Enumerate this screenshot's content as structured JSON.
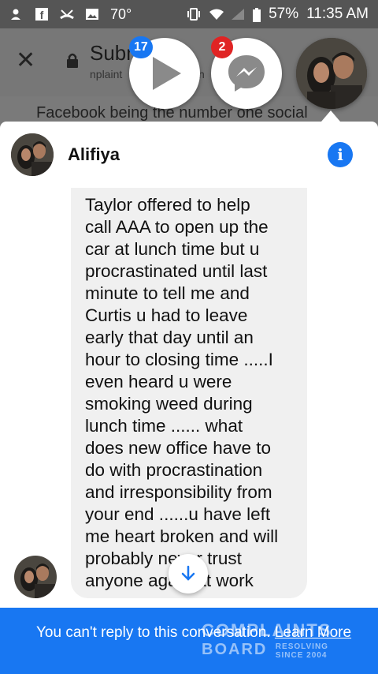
{
  "status_bar": {
    "temperature": "70°",
    "battery": "57%",
    "time": "11:35 AM"
  },
  "browser": {
    "title": "Subm",
    "url": "nplaint",
    "url_tail": "n",
    "behind_text": "Facebook being the number one social"
  },
  "chat_heads": {
    "video_badge": "17",
    "messenger_badge": "2"
  },
  "conversation": {
    "contact_name": "Alifiya",
    "message": "Taylor offered to help\ncall AAA to open up the\ncar at lunch time but u\nprocrastinated until last\nminute to tell me and\nCurtis u had to leave\nearly that day until an\nhour to closing time .....I\neven heard u were\nsmoking weed during\nlunch time ...... what\ndoes new office have to\ndo with procrastination\nand irresponsibility from\nyour end ......u have left\nme heart broken and will\nprobably never trust\nanyone again at work"
  },
  "footer": {
    "notice": "You can't reply to this conversation.",
    "link": "Learn More"
  },
  "watermark": {
    "line1": "COMPLAINTS",
    "line2": "BOARD",
    "line3": "RESOLVING",
    "line4": "SINCE 2004"
  },
  "colors": {
    "messenger_blue": "#1877f2",
    "badge_red": "#e02424",
    "bubble_gray": "#f0f0f0"
  }
}
